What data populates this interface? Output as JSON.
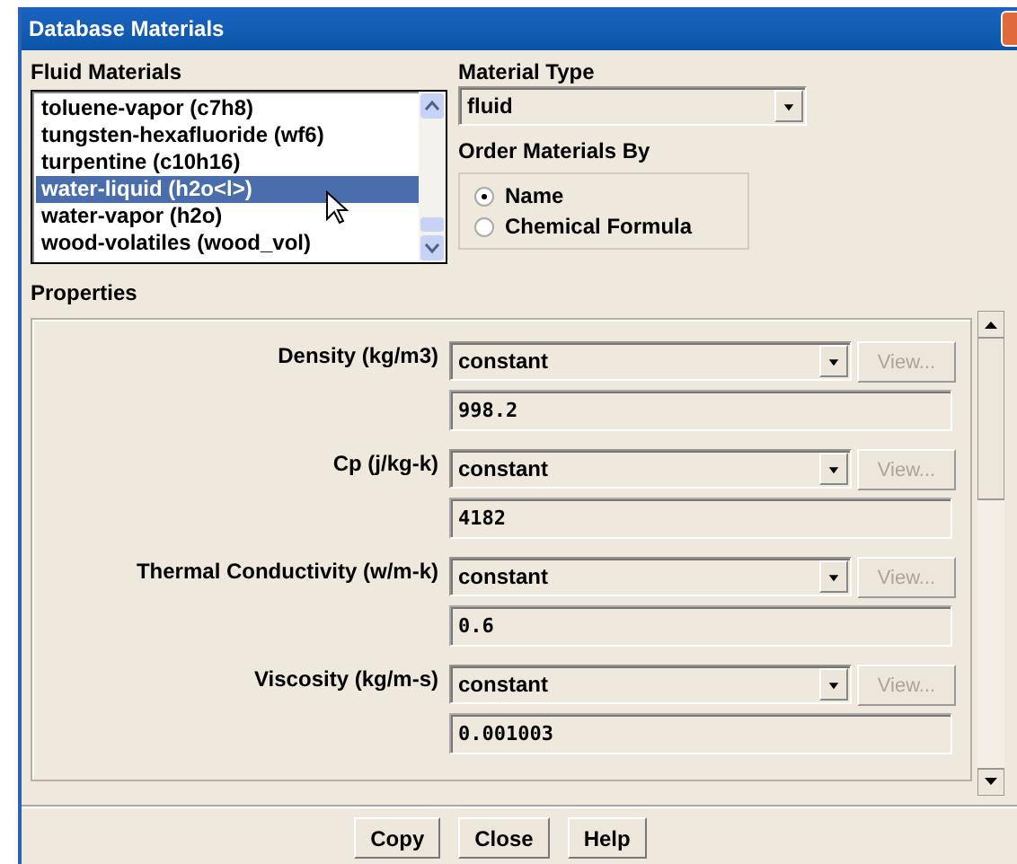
{
  "window": {
    "title": "Database Materials"
  },
  "fluid_materials": {
    "label": "Fluid Materials",
    "items": [
      {
        "name": "toluene-vapor (c7h8)",
        "selected": false
      },
      {
        "name": "tungsten-hexafluoride (wf6)",
        "selected": false
      },
      {
        "name": "turpentine (c10h16)",
        "selected": false
      },
      {
        "name": "water-liquid (h2o<l>)",
        "selected": true
      },
      {
        "name": "water-vapor (h2o)",
        "selected": false
      },
      {
        "name": "wood-volatiles (wood_vol)",
        "selected": false
      }
    ]
  },
  "material_type": {
    "label": "Material Type",
    "value": "fluid"
  },
  "order_by": {
    "label": "Order Materials By",
    "options": [
      {
        "label": "Name",
        "selected": true
      },
      {
        "label": "Chemical Formula",
        "selected": false
      }
    ]
  },
  "properties": {
    "label": "Properties",
    "rows": [
      {
        "label": "Density (kg/m3)",
        "method": "constant",
        "view": "View...",
        "view_disabled": true,
        "value": "998.2"
      },
      {
        "label": "Cp (j/kg-k)",
        "method": "constant",
        "view": "View...",
        "view_disabled": true,
        "value": "4182"
      },
      {
        "label": "Thermal Conductivity (w/m-k)",
        "method": "constant",
        "view": "View...",
        "view_disabled": true,
        "value": "0.6"
      },
      {
        "label": "Viscosity (kg/m-s)",
        "method": "constant",
        "view": "View...",
        "view_disabled": true,
        "value": "0.001003"
      }
    ]
  },
  "buttons": [
    "Copy",
    "Close",
    "Help"
  ]
}
